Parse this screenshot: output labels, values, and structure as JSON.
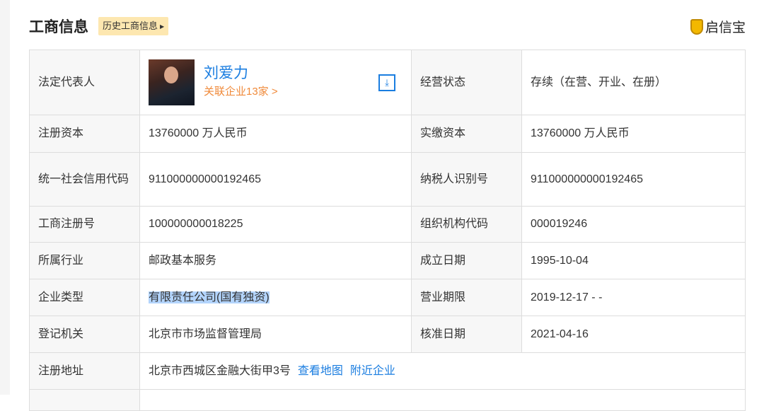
{
  "header": {
    "title": "工商信息",
    "history_button": "历史工商信息",
    "brand": "启信宝"
  },
  "legal_rep": {
    "label": "法定代表人",
    "name": "刘爱力",
    "related": "关联企业13家 >"
  },
  "rows": [
    {
      "k1": "经营状态",
      "v1": "存续（在营、开业、在册）"
    },
    {
      "k1": "注册资本",
      "v1": "13760000 万人民币",
      "k2": "实缴资本",
      "v2": "13760000 万人民币"
    },
    {
      "k1": "统一社会信用代码",
      "v1": "911000000000192465",
      "k2": "纳税人识别号",
      "v2": "911000000000192465"
    },
    {
      "k1": "工商注册号",
      "v1": "100000000018225",
      "k2": "组织机构代码",
      "v2": "000019246"
    },
    {
      "k1": "所属行业",
      "v1": "邮政基本服务",
      "k2": "成立日期",
      "v2": "1995-10-04"
    },
    {
      "k1": "企业类型",
      "v1": "有限责任公司(国有独资)",
      "k2": "营业期限",
      "v2": "2019-12-17 - -"
    },
    {
      "k1": "登记机关",
      "v1": "北京市市场监督管理局",
      "k2": "核准日期",
      "v2": "2021-04-16"
    },
    {
      "k1": "注册地址",
      "v1": "北京市西城区金融大街甲3号",
      "link1": "查看地图",
      "link2": "附近企业"
    }
  ]
}
